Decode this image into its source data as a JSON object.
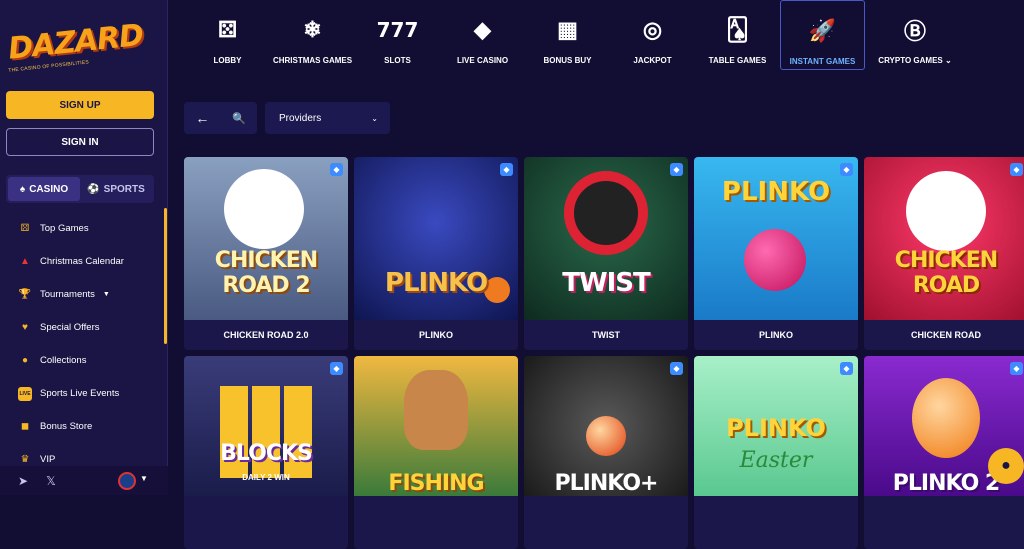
{
  "brand": {
    "name": "DAZARD",
    "tagline": "THE CASINO OF POSSIBILITIES"
  },
  "auth": {
    "signup": "SIGN UP",
    "signin": "SIGN IN"
  },
  "switch": {
    "casino": "CASINO",
    "sports": "SPORTS"
  },
  "sidebar": {
    "items": [
      {
        "label": "Top Games",
        "icon": "dice-icon"
      },
      {
        "label": "Christmas Calendar",
        "icon": "santa-hat-icon"
      },
      {
        "label": "Tournaments",
        "icon": "trophy-icon"
      },
      {
        "label": "Special Offers",
        "icon": "heart-icon"
      },
      {
        "label": "Collections",
        "icon": "cherries-icon"
      },
      {
        "label": "Sports Live Events",
        "icon": "live-icon"
      },
      {
        "label": "Bonus Store",
        "icon": "basket-icon"
      },
      {
        "label": "VIP",
        "icon": "crown-icon"
      }
    ]
  },
  "nav": [
    {
      "label": "LOBBY",
      "icon": "dice-icon"
    },
    {
      "label": "CHRISTMAS GAMES",
      "icon": "christmas-icon"
    },
    {
      "label": "SLOTS",
      "icon": "777-icon",
      "glyph": "777"
    },
    {
      "label": "LIVE CASINO",
      "icon": "live-casino-icon"
    },
    {
      "label": "BONUS BUY",
      "icon": "bonus-buy-icon"
    },
    {
      "label": "JACKPOT",
      "icon": "target-icon"
    },
    {
      "label": "TABLE GAMES",
      "icon": "playing-card-icon"
    },
    {
      "label": "INSTANT GAMES",
      "icon": "rocket-icon"
    },
    {
      "label": "CRYPTO GAMES",
      "icon": "bitcoin-icon"
    }
  ],
  "filters": {
    "providers": "Providers"
  },
  "games": [
    {
      "title": "CHICKEN ROAD 2.0",
      "art": "CHICKEN ROAD 2",
      "bg": "#6a7fa8"
    },
    {
      "title": "PLINKO",
      "art": "PLINKO",
      "bg": "#1b2a7a"
    },
    {
      "title": "TWIST",
      "art": "TWIST",
      "bg": "#1f4a3a"
    },
    {
      "title": "PLINKO",
      "art": "PLINKO",
      "bg": "#2aa6e6"
    },
    {
      "title": "CHICKEN ROAD",
      "art": "CHICKEN ROAD",
      "bg": "#d8224e"
    },
    {
      "title": "",
      "art": "BLOCKS",
      "sub": "DAILY 2 WIN",
      "bg": "#2a2c5a"
    },
    {
      "title": "",
      "art": "FISHING",
      "bg": "#4a8a3a"
    },
    {
      "title": "",
      "art": "PLINKO+",
      "bg": "#2a2a2a"
    },
    {
      "title": "",
      "art": "PLINKO",
      "sub": "Easter",
      "bg": "#8ee0b8"
    },
    {
      "title": "",
      "art": "PLINKO 2",
      "bg": "#6a1fa0"
    }
  ],
  "colors": {
    "accent": "#f7b724",
    "active_nav": "#6fb4ff",
    "bg": "#120e33"
  }
}
